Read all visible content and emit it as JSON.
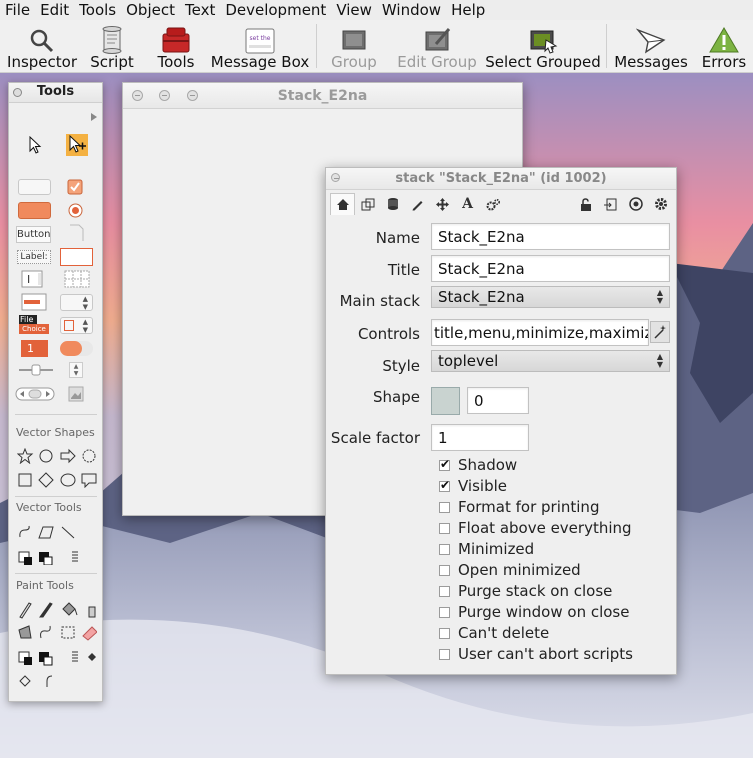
{
  "menubar": [
    "File",
    "Edit",
    "Tools",
    "Object",
    "Text",
    "Development",
    "View",
    "Window",
    "Help"
  ],
  "toolbar": {
    "inspector": "Inspector",
    "script": "Script",
    "tools": "Tools",
    "message_box": "Message Box",
    "message_box_icon_text": "set the",
    "group": "Group",
    "edit_group": "Edit Group",
    "select_grouped": "Select Grouped",
    "messages": "Messages",
    "errors": "Errors"
  },
  "palette": {
    "title": "Tools",
    "button_label": "Button",
    "label_label": "Label:",
    "file_text": "File",
    "choice_text": "Choice",
    "number_one": "1",
    "vector_shapes": "Vector Shapes",
    "vector_tools": "Vector Tools",
    "paint_tools": "Paint Tools"
  },
  "stack_window": {
    "title": "Stack_E2na"
  },
  "inspector": {
    "title": "stack \"Stack_E2na\" (id 1002)",
    "name_label": "Name",
    "name_value": "Stack_E2na",
    "title_label": "Title",
    "title_value": "Stack_E2na",
    "mainstack_label": "Main stack",
    "mainstack_value": "Stack_E2na",
    "controls_label": "Controls",
    "controls_value": "title,menu,minimize,maximize,c",
    "style_label": "Style",
    "style_value": "toplevel",
    "shape_label": "Shape",
    "shape_value": "0",
    "scale_label": "Scale factor",
    "scale_value": "1",
    "checkboxes": [
      {
        "label": "Shadow",
        "checked": true
      },
      {
        "label": "Visible",
        "checked": true
      },
      {
        "label": "Format for printing",
        "checked": false
      },
      {
        "label": "Float above everything",
        "checked": false
      },
      {
        "label": "Minimized",
        "checked": false
      },
      {
        "label": "Open minimized",
        "checked": false
      },
      {
        "label": "Purge stack on close",
        "checked": false
      },
      {
        "label": "Purge window on close",
        "checked": false
      },
      {
        "label": "Can't delete",
        "checked": false
      },
      {
        "label": "User can't abort scripts",
        "checked": false
      }
    ]
  },
  "colors": {
    "accent_orange": "#f08a5d",
    "errors_green": "#7cb342",
    "tools_red": "#c62828"
  }
}
